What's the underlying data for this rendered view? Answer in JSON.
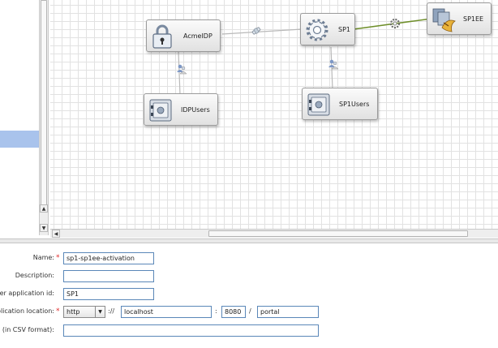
{
  "diagram": {
    "nodes": {
      "acme_idp": {
        "label": "AcmeIDP",
        "icon": "lock-icon"
      },
      "sp1": {
        "label": "SP1",
        "icon": "gear-icon"
      },
      "sp1ee": {
        "label": "SP1EE",
        "icon": "app-server-icon"
      },
      "idp_users": {
        "label": "IDPUsers",
        "icon": "user-store-icon"
      },
      "sp1_users": {
        "label": "SP1Users",
        "icon": "user-store-icon"
      }
    },
    "edges": [
      {
        "from": "acme_idp",
        "to": "sp1",
        "icon": "federation-link-icon"
      },
      {
        "from": "sp1",
        "to": "sp1ee",
        "icon": "activation-gear-icon",
        "color": "#6f8f2a"
      },
      {
        "from": "acme_idp",
        "to": "idp_users",
        "icon": "users-link-icon"
      },
      {
        "from": "sp1",
        "to": "sp1_users",
        "icon": "users-link-icon"
      }
    ]
  },
  "form": {
    "name": {
      "label": "Name:",
      "value": "sp1-sp1ee-activation",
      "required": "*"
    },
    "description": {
      "label": "Description:",
      "value": ""
    },
    "partner_app_id": {
      "label": "er application id:",
      "value": "SP1"
    },
    "app_location": {
      "label": "plication location:",
      "required": "*",
      "protocol": "http",
      "protocol_sep": "://",
      "host": "localhost",
      "port_sep": ":",
      "port": "8080",
      "path_sep": "/",
      "path": "portal"
    },
    "csv": {
      "label": "(in CSV format):",
      "value": ""
    }
  },
  "colors": {
    "selection": "#a9c3ec",
    "required": "#e02b2b",
    "activation_edge": "#6f8f2a"
  }
}
